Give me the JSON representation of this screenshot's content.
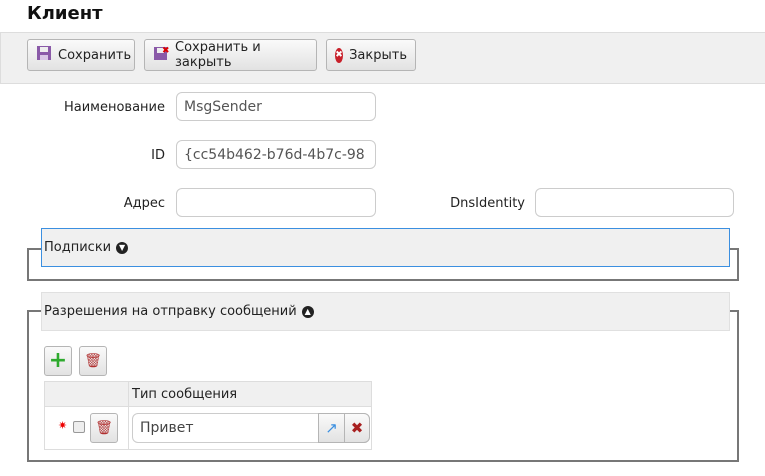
{
  "title": "Клиент",
  "toolbar": {
    "save": "Сохранить",
    "save_close": "Сохранить и закрыть",
    "close": "Закрыть"
  },
  "form": {
    "name_label": "Наименование",
    "name_value": "MsgSender",
    "id_label": "ID",
    "id_value": "{cc54b462-b76d-4b7c-98",
    "address_label": "Адрес",
    "address_value": "",
    "dns_label": "DnsIdentity",
    "dns_value": ""
  },
  "subscriptions": {
    "legend": "Подписки"
  },
  "permissions": {
    "legend": "Разрешения на отправку сообщений",
    "column_header": "Тип сообщения",
    "rows": [
      {
        "message_type": "Привет"
      }
    ]
  }
}
